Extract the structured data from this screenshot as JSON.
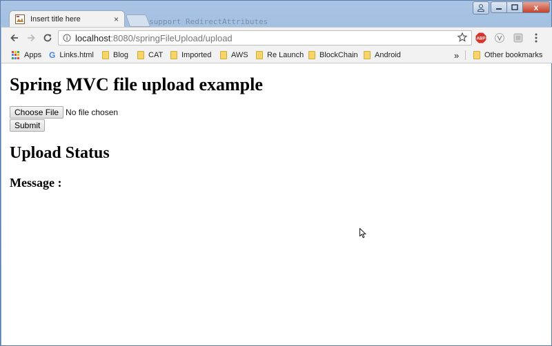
{
  "browser": {
    "tab_title": "Insert title here",
    "tab_close": "×",
    "background_text": "support RedirectAttributes",
    "window_controls": {
      "close": "x"
    }
  },
  "toolbar": {
    "url_host": "localhost",
    "url_path": ":8080/springFileUpload/upload"
  },
  "bookmarks": {
    "items": [
      {
        "label": "Apps",
        "icon": "apps-grid-icon"
      },
      {
        "label": "Links.html",
        "icon": "google-icon"
      },
      {
        "label": "Blog",
        "icon": "folder-icon"
      },
      {
        "label": "CAT",
        "icon": "folder-icon"
      },
      {
        "label": "Imported",
        "icon": "folder-icon"
      },
      {
        "label": "AWS",
        "icon": "folder-icon"
      },
      {
        "label": "Re Launch",
        "icon": "folder-icon"
      },
      {
        "label": "BlockChain",
        "icon": "folder-icon"
      },
      {
        "label": "Android",
        "icon": "folder-icon"
      }
    ],
    "overflow": "»",
    "other": "Other bookmarks"
  },
  "page": {
    "title": "Spring MVC file upload example",
    "choose_file_label": "Choose File",
    "no_file_text": "No file chosen",
    "submit_label": "Submit",
    "status_heading": "Upload Status",
    "message_label": "Message :"
  },
  "colors": {
    "close_button": "#c3412b",
    "folder": "#f6d66b",
    "abp": "#d9342b"
  }
}
